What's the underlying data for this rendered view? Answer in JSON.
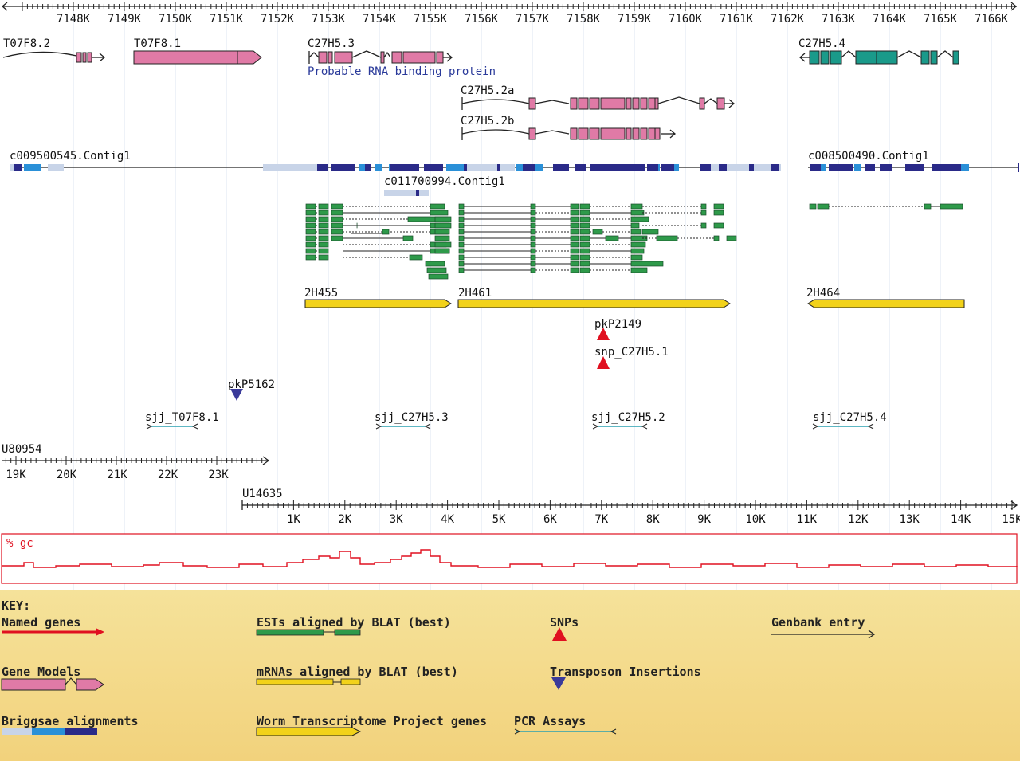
{
  "top_ruler": {
    "labels": [
      "7148K",
      "7149K",
      "7150K",
      "7151K",
      "7152K",
      "7153K",
      "7154K",
      "7155K",
      "7156K",
      "7157K",
      "7158K",
      "7159K",
      "7160K",
      "7161K",
      "7162K",
      "7163K",
      "7164K",
      "7165K",
      "7166K"
    ]
  },
  "named_genes": [
    {
      "name": "T07F8.2"
    },
    {
      "name": "T07F8.1"
    },
    {
      "name": "C27H5.3",
      "description": "Probable RNA binding protein"
    },
    {
      "name": "C27H5.4"
    },
    {
      "name": "C27H5.2a"
    },
    {
      "name": "C27H5.2b"
    }
  ],
  "contigs": [
    "c009500545.Contig1",
    "c008500490.Contig1",
    "c011700994.Contig1"
  ],
  "wtp_genes": [
    "2H455",
    "2H461",
    "2H464"
  ],
  "snps": [
    "pkP2149",
    "snp_C27H5.1"
  ],
  "transposons": [
    "pkP5162"
  ],
  "pcr_assays": [
    "sjj_T07F8.1",
    "sjj_C27H5.3",
    "sjj_C27H5.2",
    "sjj_C27H5.4"
  ],
  "genbank_u80954": {
    "name": "U80954",
    "labels": [
      "19K",
      "20K",
      "21K",
      "22K",
      "23K"
    ]
  },
  "genbank_u14635": {
    "name": "U14635",
    "labels": [
      "1K",
      "2K",
      "3K",
      "4K",
      "5K",
      "6K",
      "7K",
      "8K",
      "9K",
      "10K",
      "11K",
      "12K",
      "13K",
      "14K",
      "15K"
    ]
  },
  "gc_track": {
    "label": "% gc"
  },
  "key": {
    "title": "KEY:",
    "items": [
      "Named genes",
      "ESTs aligned by BLAT (best)",
      "SNPs",
      "Genbank entry",
      "Gene Models",
      "mRNAs aligned by BLAT (best)",
      "Transposon Insertions",
      "Briggsae alignments",
      "Worm Transcriptome Project genes",
      "PCR Assays"
    ]
  },
  "colors": {
    "gene_model": "#e07aa6",
    "gene_model_minus": "#1a9a8a",
    "est": "#2e9a4a",
    "mrna_wtp": "#f2d21a",
    "snp": "#e01020",
    "transposon": "#3a3a9a",
    "pcr": "#2aa0b0",
    "briggsae_dark": "#2a2a88",
    "briggsae_mid": "#2a90d8",
    "briggsae_light": "#c8d4e8",
    "gc_line": "#e01020",
    "named_gene": "#e01020",
    "key_bg": "#f7dd8e"
  }
}
